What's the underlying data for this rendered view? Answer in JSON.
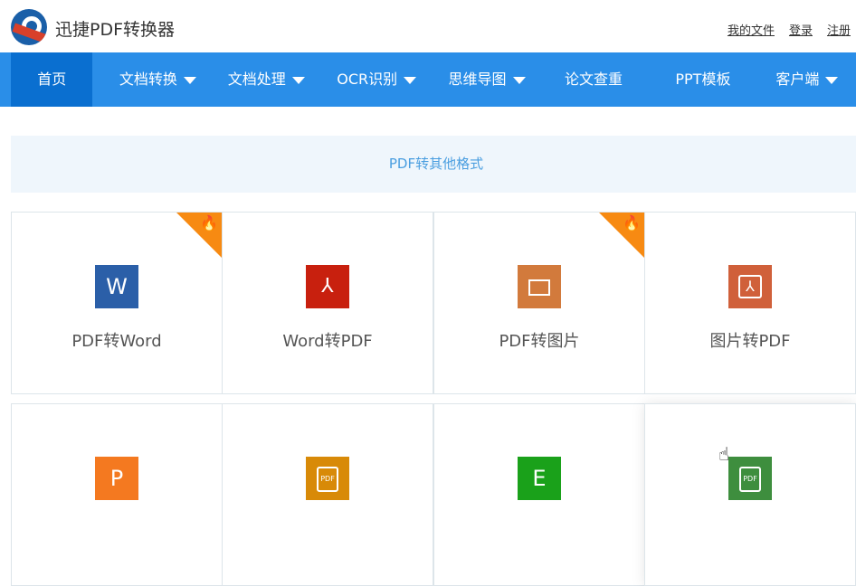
{
  "header": {
    "brand": "迅捷PDF转换器",
    "links": [
      "我的文件",
      "登录",
      "注册"
    ]
  },
  "nav": {
    "items": [
      {
        "label": "首页",
        "active": true
      },
      {
        "label": "文档转换",
        "dropdown": true
      },
      {
        "label": "文档处理",
        "dropdown": true
      },
      {
        "label": "OCR识别",
        "dropdown": true
      },
      {
        "label": "思维导图",
        "dropdown": true
      },
      {
        "label": "论文查重"
      },
      {
        "label": "PPT模板"
      },
      {
        "label": "客户端",
        "dropdown": true
      }
    ]
  },
  "banner": {
    "text": "PDF转其他格式"
  },
  "tools": [
    {
      "label": "PDF转Word",
      "icon": "W",
      "icon_color": "#2b5fa8",
      "hot": true
    },
    {
      "label": "Word转PDF",
      "icon": "pdf-acrobat-icon",
      "icon_color": "#c8200e",
      "hot": false
    },
    {
      "label": "PDF转图片",
      "icon": "image-icon",
      "icon_color": "#d27a3c",
      "hot": true
    },
    {
      "label": "图片转PDF",
      "icon": "pdf-acrobat-icon",
      "icon_color": "#d0603a",
      "hot": false
    },
    {
      "label": "",
      "icon": "P",
      "icon_color": "#f47920"
    },
    {
      "label": "",
      "icon": "pdf-slides-icon",
      "icon_color": "#d88a08"
    },
    {
      "label": "",
      "icon": "E",
      "icon_color": "#1aa11a"
    },
    {
      "label": "",
      "icon": "pdf-file-icon",
      "icon_color": "#3e8e3e",
      "hovered": true
    }
  ],
  "icon_text": {
    "pdf": "PDF"
  }
}
